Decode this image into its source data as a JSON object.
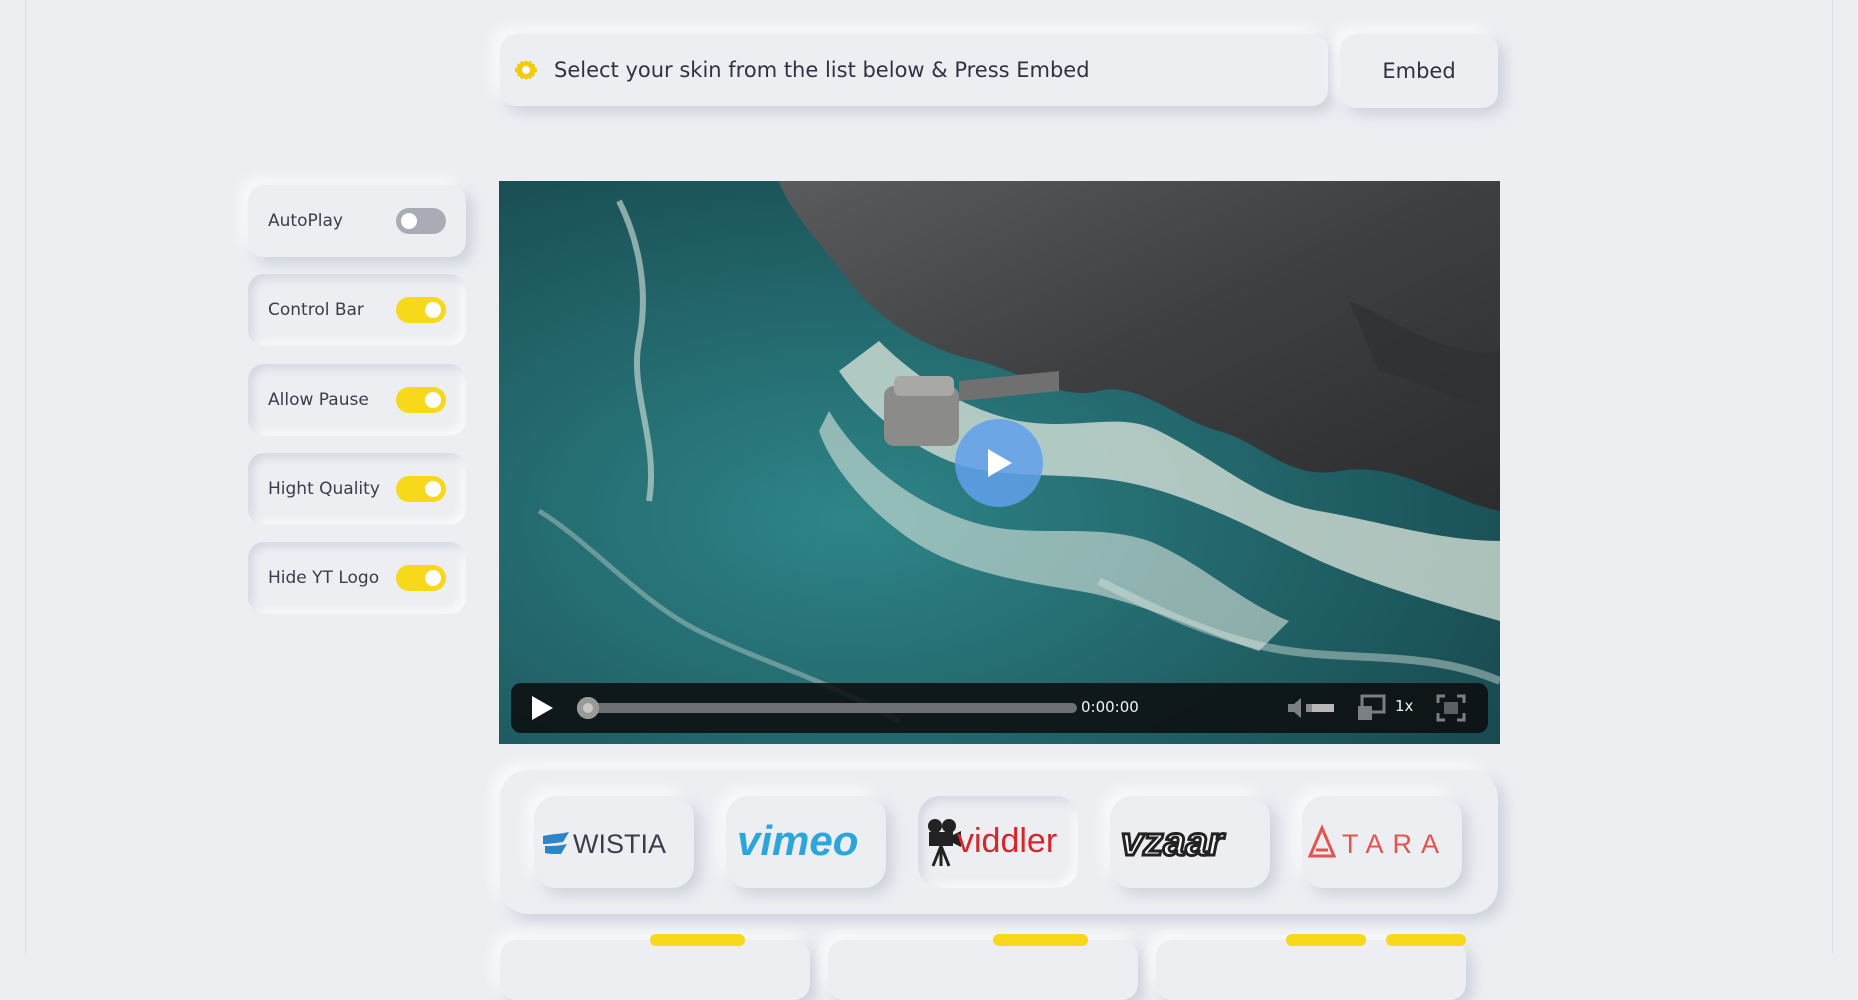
{
  "topbar": {
    "message": "Select your skin from the list below & Press Embed",
    "icon": "gear-icon"
  },
  "embed_button": {
    "label": "Embed"
  },
  "toggles": [
    {
      "label": "AutoPlay",
      "on": false
    },
    {
      "label": "Control Bar",
      "on": true
    },
    {
      "label": "Allow Pause",
      "on": true
    },
    {
      "label": "Hight Quality",
      "on": true
    },
    {
      "label": "Hide YT Logo",
      "on": true
    }
  ],
  "player": {
    "time": "0:00:00",
    "speed": "1x",
    "progress": 0
  },
  "skins": [
    {
      "label": "WISTIA",
      "icon": "wistia-logo"
    },
    {
      "label": "vimeo",
      "icon": "vimeo-logo"
    },
    {
      "label": "viddler",
      "icon": "viddler-logo"
    },
    {
      "label": "vzaar",
      "icon": "vzaar-logo"
    },
    {
      "label": "TARA",
      "icon": "tara-logo"
    }
  ],
  "colors": {
    "accent": "#f7d81b",
    "background": "#eceef2",
    "play_button": "#60a0eb"
  }
}
